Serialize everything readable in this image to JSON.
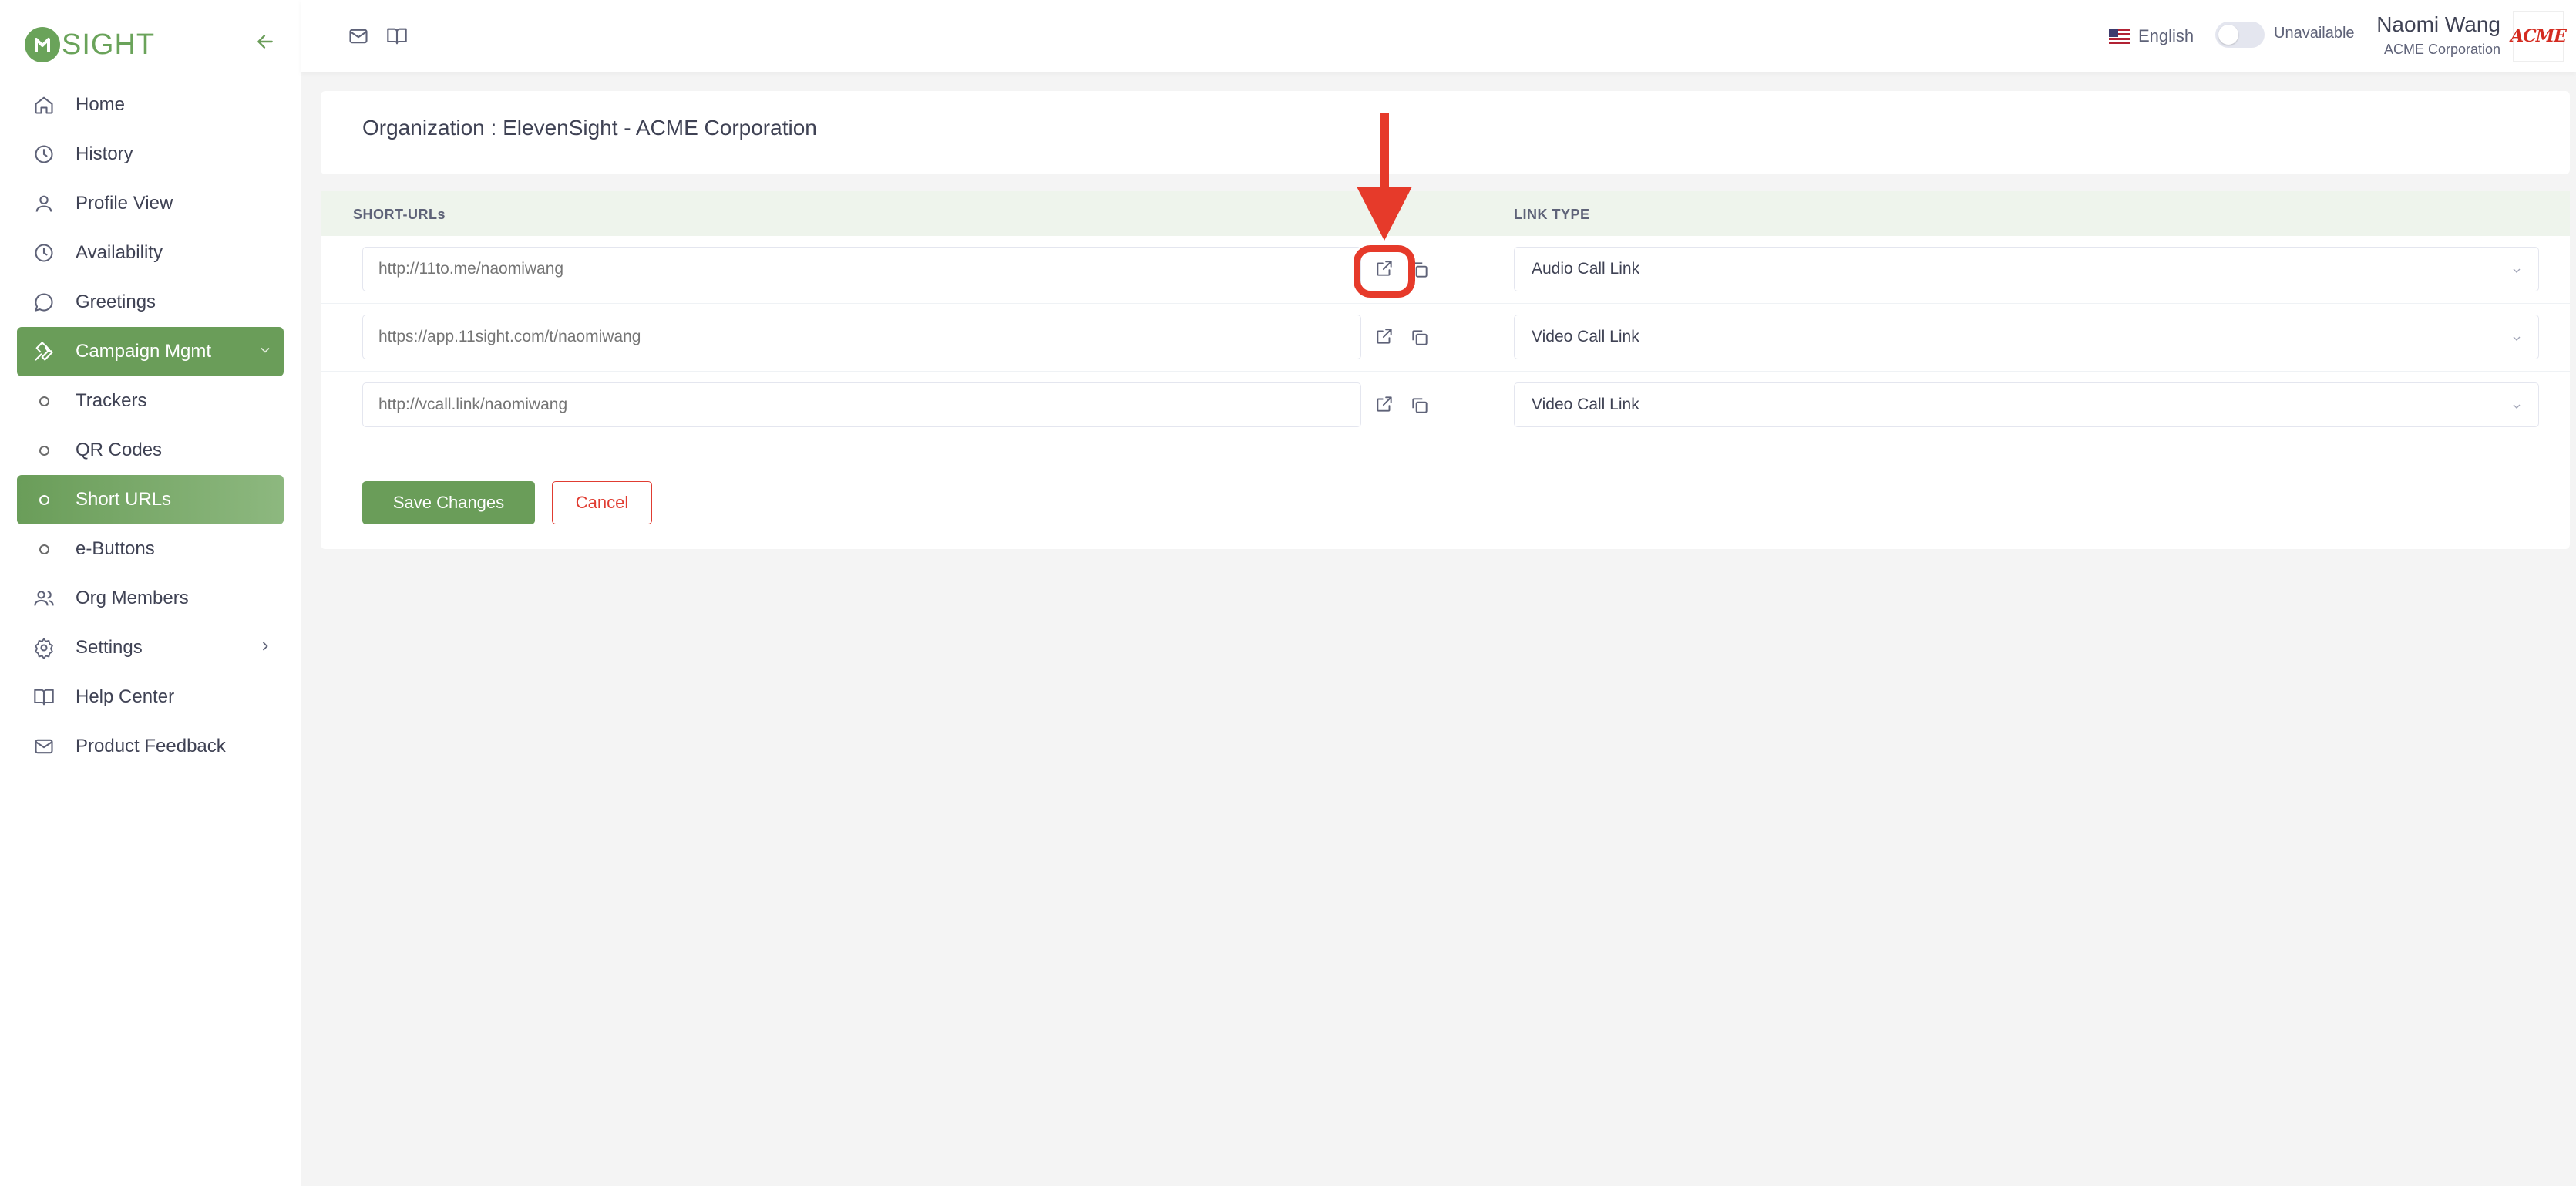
{
  "brand": {
    "logo_letter": "",
    "logo_text": "SIGHT",
    "accent": "#6a9d59"
  },
  "sidebar": {
    "items": [
      {
        "label": "Home",
        "icon": "home-icon"
      },
      {
        "label": "History",
        "icon": "clock-icon"
      },
      {
        "label": "Profile View",
        "icon": "user-icon"
      },
      {
        "label": "Availability",
        "icon": "clock-icon"
      },
      {
        "label": "Greetings",
        "icon": "chat-icon"
      },
      {
        "label": "Campaign Mgmt",
        "icon": "wrench-icon",
        "active": true,
        "expanded": true
      },
      {
        "label": "Trackers",
        "icon": "circle-icon",
        "sub": true
      },
      {
        "label": "QR Codes",
        "icon": "circle-icon",
        "sub": true
      },
      {
        "label": "Short URLs",
        "icon": "circle-icon",
        "sub": true,
        "active": true
      },
      {
        "label": "e-Buttons",
        "icon": "circle-icon",
        "sub": true
      },
      {
        "label": "Org Members",
        "icon": "users-icon"
      },
      {
        "label": "Settings",
        "icon": "gear-icon"
      },
      {
        "label": "Help Center",
        "icon": "book-icon"
      },
      {
        "label": "Product Feedback",
        "icon": "mail-icon"
      }
    ]
  },
  "topbar": {
    "language": "English",
    "availability_label": "Unavailable",
    "user_name": "Naomi Wang",
    "user_org": "ACME Corporation",
    "avatar_text": "ACME"
  },
  "org_header": {
    "title": "Organization : ElevenSight - ACME Corporation"
  },
  "table": {
    "headers": {
      "short_urls": "SHORT-URLs",
      "link_type": "LINK TYPE"
    },
    "rows": [
      {
        "url": "http://11to.me/naomiwang",
        "link_type": "Audio Call Link"
      },
      {
        "url": "https://app.11sight.com/t/naomiwang",
        "link_type": "Video Call Link"
      },
      {
        "url": "http://vcall.link/naomiwang",
        "link_type": "Video Call Link"
      }
    ]
  },
  "actions": {
    "save": "Save Changes",
    "cancel": "Cancel"
  },
  "annotation": {
    "color": "#e63a2a"
  }
}
